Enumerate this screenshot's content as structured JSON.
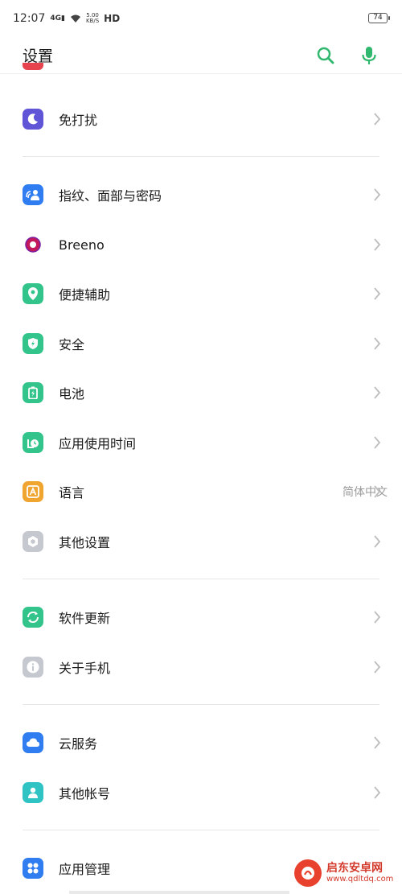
{
  "status": {
    "time": "12:07",
    "signal": "4G",
    "netspeed_value": "5.00",
    "netspeed_unit": "KB/S",
    "hd": "HD",
    "battery": "74"
  },
  "header": {
    "title": "设置"
  },
  "items": [
    {
      "label": "免打扰",
      "icon": "moon-icon",
      "color": "#5f55d6"
    },
    {
      "label": "指纹、面部与密码",
      "icon": "fingerprint-face-icon",
      "color": "#2f7df0"
    },
    {
      "label": "Breeno",
      "icon": "breeno-icon",
      "color": "#ffffff"
    },
    {
      "label": "便捷辅助",
      "icon": "assist-icon",
      "color": "#33c48b"
    },
    {
      "label": "安全",
      "icon": "shield-icon",
      "color": "#33c48b"
    },
    {
      "label": "电池",
      "icon": "battery-icon",
      "color": "#33c48b"
    },
    {
      "label": "应用使用时间",
      "icon": "app-time-icon",
      "color": "#33c48b"
    },
    {
      "label": "语言",
      "value": "简体中文",
      "icon": "language-icon",
      "color": "#f0a530"
    },
    {
      "label": "其他设置",
      "icon": "other-settings-icon",
      "color": "#c5c8cf"
    },
    {
      "label": "软件更新",
      "icon": "update-icon",
      "color": "#33c48b"
    },
    {
      "label": "关于手机",
      "icon": "info-icon",
      "color": "#c5c8cf"
    },
    {
      "label": "云服务",
      "icon": "cloud-icon",
      "color": "#2f7df0"
    },
    {
      "label": "其他帐号",
      "icon": "account-icon",
      "color": "#2fc3c3"
    },
    {
      "label": "应用管理",
      "icon": "app-manage-icon",
      "color": "#2f7df0"
    }
  ],
  "watermark": {
    "name": "启东安卓网",
    "url": "www.qdltdq.com"
  }
}
